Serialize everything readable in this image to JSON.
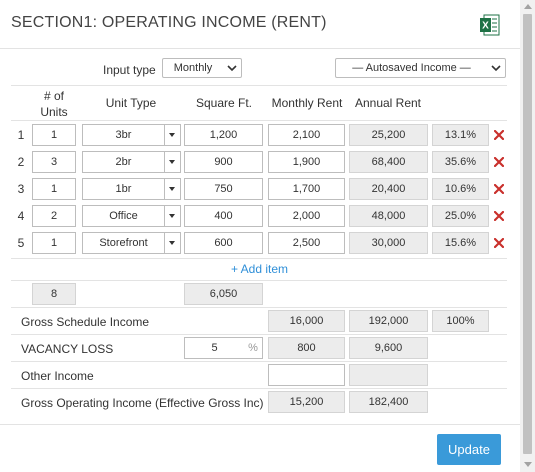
{
  "section_title": "SECTION1: OPERATING INCOME (RENT)",
  "excel_icon": "excel-export-icon",
  "input_type": {
    "label": "Input type",
    "value": "Monthly"
  },
  "autosaved": {
    "value": "— Autosaved Income —"
  },
  "columns": {
    "units": "# of\nUnits",
    "unit_type": "Unit Type",
    "sqft": "Square Ft.",
    "monthly_rent": "Monthly Rent",
    "annual_rent": "Annual Rent"
  },
  "rows": [
    {
      "num": "1",
      "units": "1",
      "type": "3br",
      "sqft": "1,200",
      "monthly": "2,100",
      "annual": "25,200",
      "pct": "13.1%"
    },
    {
      "num": "2",
      "units": "3",
      "type": "2br",
      "sqft": "900",
      "monthly": "1,900",
      "annual": "68,400",
      "pct": "35.6%"
    },
    {
      "num": "3",
      "units": "1",
      "type": "1br",
      "sqft": "750",
      "monthly": "1,700",
      "annual": "20,400",
      "pct": "10.6%"
    },
    {
      "num": "4",
      "units": "2",
      "type": "Office",
      "sqft": "400",
      "monthly": "2,000",
      "annual": "48,000",
      "pct": "25.0%"
    },
    {
      "num": "5",
      "units": "1",
      "type": "Storefront",
      "sqft": "600",
      "monthly": "2,500",
      "annual": "30,000",
      "pct": "15.6%"
    }
  ],
  "add_item": "+ Add item",
  "totals": {
    "units": "8",
    "sqft": "6,050"
  },
  "gross_schedule": {
    "label": "Gross Schedule Income",
    "monthly": "16,000",
    "annual": "192,000",
    "pct": "100%"
  },
  "vacancy": {
    "label": "VACANCY LOSS",
    "percent": "5",
    "unit": "%",
    "monthly": "800",
    "annual": "9,600"
  },
  "other_income": {
    "label": "Other Income",
    "monthly": "",
    "annual": ""
  },
  "gross_operating": {
    "label": "Gross Operating Income (Effective Gross Inc)",
    "monthly": "15,200",
    "annual": "182,400"
  },
  "update_label": "Update",
  "colors": {
    "accent": "#3a9ad9",
    "delete": "#c9302c",
    "excel": "#1e7145",
    "link": "#2f8fd8"
  }
}
